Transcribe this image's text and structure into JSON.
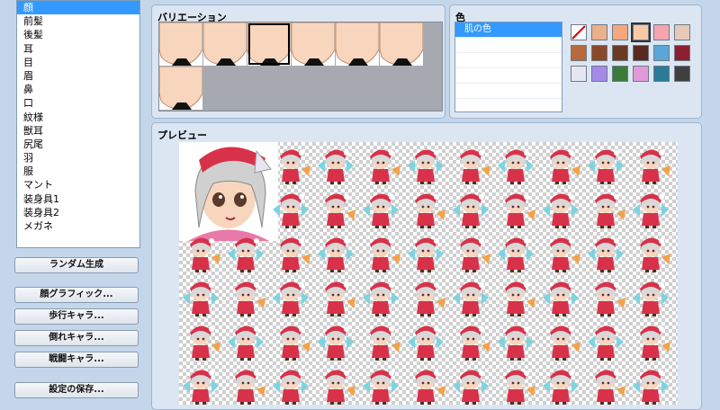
{
  "parts": {
    "items": [
      "顔",
      "前髪",
      "後髪",
      "耳",
      "目",
      "眉",
      "鼻",
      "口",
      "紋様",
      "獣耳",
      "尻尾",
      "羽",
      "服",
      "マント",
      "装身具1",
      "装身具2",
      "メガネ"
    ],
    "selected_index": 0
  },
  "buttons": {
    "random": "ランダム生成",
    "face_graphic": "顔グラフィック...",
    "walk_char": "歩行キャラ...",
    "down_char": "倒れキャラ...",
    "battle_char": "戦闘キャラ...",
    "save_settings": "設定の保存..."
  },
  "variation": {
    "title": "バリエーション",
    "count": 7,
    "selected_index": 2
  },
  "color": {
    "title": "色",
    "items": [
      "肌の色"
    ],
    "selected_index": 0,
    "swatches": [
      "none",
      "#e9b08a",
      "#f3a77b",
      "#f7c9a6",
      "#f4a5b0",
      "#e8c8b8",
      "#b86a3c",
      "#8a4a2a",
      "#6a3a22",
      "#5a2a20",
      "#5aa6d8",
      "#8a2030",
      "#e6e6f2",
      "#a48ae8",
      "#3c7a3a",
      "#e09ad8",
      "#2a7a9a",
      "#404040"
    ],
    "selected_swatch": 3
  },
  "preview": {
    "title": "プレビュー"
  },
  "colors": {
    "background": "#c4d6ea",
    "selection": "#3399ff",
    "skin": "#f8d6bd",
    "hat_red": "#d8324a",
    "hair": "#d8d8d8"
  }
}
